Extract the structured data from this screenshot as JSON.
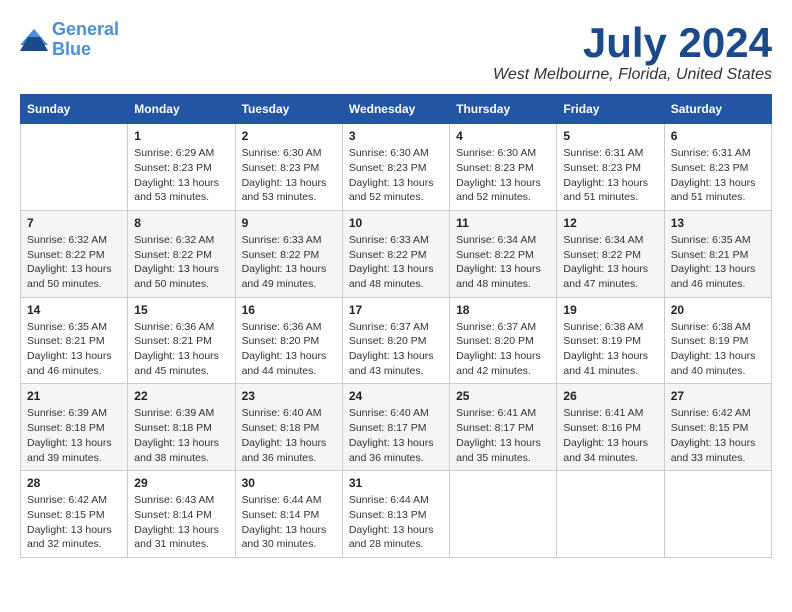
{
  "header": {
    "logo_line1": "General",
    "logo_line2": "Blue",
    "month": "July 2024",
    "location": "West Melbourne, Florida, United States"
  },
  "weekdays": [
    "Sunday",
    "Monday",
    "Tuesday",
    "Wednesday",
    "Thursday",
    "Friday",
    "Saturday"
  ],
  "weeks": [
    [
      {
        "day": "",
        "info": ""
      },
      {
        "day": "1",
        "info": "Sunrise: 6:29 AM\nSunset: 8:23 PM\nDaylight: 13 hours\nand 53 minutes."
      },
      {
        "day": "2",
        "info": "Sunrise: 6:30 AM\nSunset: 8:23 PM\nDaylight: 13 hours\nand 53 minutes."
      },
      {
        "day": "3",
        "info": "Sunrise: 6:30 AM\nSunset: 8:23 PM\nDaylight: 13 hours\nand 52 minutes."
      },
      {
        "day": "4",
        "info": "Sunrise: 6:30 AM\nSunset: 8:23 PM\nDaylight: 13 hours\nand 52 minutes."
      },
      {
        "day": "5",
        "info": "Sunrise: 6:31 AM\nSunset: 8:23 PM\nDaylight: 13 hours\nand 51 minutes."
      },
      {
        "day": "6",
        "info": "Sunrise: 6:31 AM\nSunset: 8:23 PM\nDaylight: 13 hours\nand 51 minutes."
      }
    ],
    [
      {
        "day": "7",
        "info": "Sunrise: 6:32 AM\nSunset: 8:22 PM\nDaylight: 13 hours\nand 50 minutes."
      },
      {
        "day": "8",
        "info": "Sunrise: 6:32 AM\nSunset: 8:22 PM\nDaylight: 13 hours\nand 50 minutes."
      },
      {
        "day": "9",
        "info": "Sunrise: 6:33 AM\nSunset: 8:22 PM\nDaylight: 13 hours\nand 49 minutes."
      },
      {
        "day": "10",
        "info": "Sunrise: 6:33 AM\nSunset: 8:22 PM\nDaylight: 13 hours\nand 48 minutes."
      },
      {
        "day": "11",
        "info": "Sunrise: 6:34 AM\nSunset: 8:22 PM\nDaylight: 13 hours\nand 48 minutes."
      },
      {
        "day": "12",
        "info": "Sunrise: 6:34 AM\nSunset: 8:22 PM\nDaylight: 13 hours\nand 47 minutes."
      },
      {
        "day": "13",
        "info": "Sunrise: 6:35 AM\nSunset: 8:21 PM\nDaylight: 13 hours\nand 46 minutes."
      }
    ],
    [
      {
        "day": "14",
        "info": "Sunrise: 6:35 AM\nSunset: 8:21 PM\nDaylight: 13 hours\nand 46 minutes."
      },
      {
        "day": "15",
        "info": "Sunrise: 6:36 AM\nSunset: 8:21 PM\nDaylight: 13 hours\nand 45 minutes."
      },
      {
        "day": "16",
        "info": "Sunrise: 6:36 AM\nSunset: 8:20 PM\nDaylight: 13 hours\nand 44 minutes."
      },
      {
        "day": "17",
        "info": "Sunrise: 6:37 AM\nSunset: 8:20 PM\nDaylight: 13 hours\nand 43 minutes."
      },
      {
        "day": "18",
        "info": "Sunrise: 6:37 AM\nSunset: 8:20 PM\nDaylight: 13 hours\nand 42 minutes."
      },
      {
        "day": "19",
        "info": "Sunrise: 6:38 AM\nSunset: 8:19 PM\nDaylight: 13 hours\nand 41 minutes."
      },
      {
        "day": "20",
        "info": "Sunrise: 6:38 AM\nSunset: 8:19 PM\nDaylight: 13 hours\nand 40 minutes."
      }
    ],
    [
      {
        "day": "21",
        "info": "Sunrise: 6:39 AM\nSunset: 8:18 PM\nDaylight: 13 hours\nand 39 minutes."
      },
      {
        "day": "22",
        "info": "Sunrise: 6:39 AM\nSunset: 8:18 PM\nDaylight: 13 hours\nand 38 minutes."
      },
      {
        "day": "23",
        "info": "Sunrise: 6:40 AM\nSunset: 8:18 PM\nDaylight: 13 hours\nand 36 minutes."
      },
      {
        "day": "24",
        "info": "Sunrise: 6:40 AM\nSunset: 8:17 PM\nDaylight: 13 hours\nand 36 minutes."
      },
      {
        "day": "25",
        "info": "Sunrise: 6:41 AM\nSunset: 8:17 PM\nDaylight: 13 hours\nand 35 minutes."
      },
      {
        "day": "26",
        "info": "Sunrise: 6:41 AM\nSunset: 8:16 PM\nDaylight: 13 hours\nand 34 minutes."
      },
      {
        "day": "27",
        "info": "Sunrise: 6:42 AM\nSunset: 8:15 PM\nDaylight: 13 hours\nand 33 minutes."
      }
    ],
    [
      {
        "day": "28",
        "info": "Sunrise: 6:42 AM\nSunset: 8:15 PM\nDaylight: 13 hours\nand 32 minutes."
      },
      {
        "day": "29",
        "info": "Sunrise: 6:43 AM\nSunset: 8:14 PM\nDaylight: 13 hours\nand 31 minutes."
      },
      {
        "day": "30",
        "info": "Sunrise: 6:44 AM\nSunset: 8:14 PM\nDaylight: 13 hours\nand 30 minutes."
      },
      {
        "day": "31",
        "info": "Sunrise: 6:44 AM\nSunset: 8:13 PM\nDaylight: 13 hours\nand 28 minutes."
      },
      {
        "day": "",
        "info": ""
      },
      {
        "day": "",
        "info": ""
      },
      {
        "day": "",
        "info": ""
      }
    ]
  ]
}
